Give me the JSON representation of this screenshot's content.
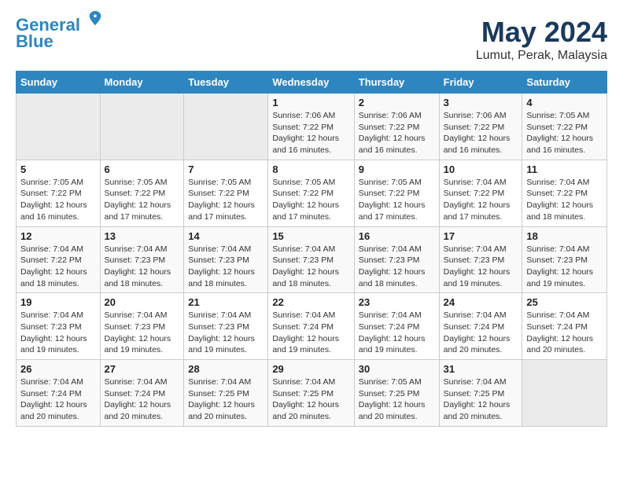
{
  "header": {
    "logo_line1": "General",
    "logo_line2": "Blue",
    "month": "May 2024",
    "location": "Lumut, Perak, Malaysia"
  },
  "weekdays": [
    "Sunday",
    "Monday",
    "Tuesday",
    "Wednesday",
    "Thursday",
    "Friday",
    "Saturday"
  ],
  "weeks": [
    [
      {
        "day": "",
        "sunrise": "",
        "sunset": "",
        "daylight": ""
      },
      {
        "day": "",
        "sunrise": "",
        "sunset": "",
        "daylight": ""
      },
      {
        "day": "",
        "sunrise": "",
        "sunset": "",
        "daylight": ""
      },
      {
        "day": "1",
        "sunrise": "Sunrise: 7:06 AM",
        "sunset": "Sunset: 7:22 PM",
        "daylight": "Daylight: 12 hours and 16 minutes."
      },
      {
        "day": "2",
        "sunrise": "Sunrise: 7:06 AM",
        "sunset": "Sunset: 7:22 PM",
        "daylight": "Daylight: 12 hours and 16 minutes."
      },
      {
        "day": "3",
        "sunrise": "Sunrise: 7:06 AM",
        "sunset": "Sunset: 7:22 PM",
        "daylight": "Daylight: 12 hours and 16 minutes."
      },
      {
        "day": "4",
        "sunrise": "Sunrise: 7:05 AM",
        "sunset": "Sunset: 7:22 PM",
        "daylight": "Daylight: 12 hours and 16 minutes."
      }
    ],
    [
      {
        "day": "5",
        "sunrise": "Sunrise: 7:05 AM",
        "sunset": "Sunset: 7:22 PM",
        "daylight": "Daylight: 12 hours and 16 minutes."
      },
      {
        "day": "6",
        "sunrise": "Sunrise: 7:05 AM",
        "sunset": "Sunset: 7:22 PM",
        "daylight": "Daylight: 12 hours and 17 minutes."
      },
      {
        "day": "7",
        "sunrise": "Sunrise: 7:05 AM",
        "sunset": "Sunset: 7:22 PM",
        "daylight": "Daylight: 12 hours and 17 minutes."
      },
      {
        "day": "8",
        "sunrise": "Sunrise: 7:05 AM",
        "sunset": "Sunset: 7:22 PM",
        "daylight": "Daylight: 12 hours and 17 minutes."
      },
      {
        "day": "9",
        "sunrise": "Sunrise: 7:05 AM",
        "sunset": "Sunset: 7:22 PM",
        "daylight": "Daylight: 12 hours and 17 minutes."
      },
      {
        "day": "10",
        "sunrise": "Sunrise: 7:04 AM",
        "sunset": "Sunset: 7:22 PM",
        "daylight": "Daylight: 12 hours and 17 minutes."
      },
      {
        "day": "11",
        "sunrise": "Sunrise: 7:04 AM",
        "sunset": "Sunset: 7:22 PM",
        "daylight": "Daylight: 12 hours and 18 minutes."
      }
    ],
    [
      {
        "day": "12",
        "sunrise": "Sunrise: 7:04 AM",
        "sunset": "Sunset: 7:22 PM",
        "daylight": "Daylight: 12 hours and 18 minutes."
      },
      {
        "day": "13",
        "sunrise": "Sunrise: 7:04 AM",
        "sunset": "Sunset: 7:23 PM",
        "daylight": "Daylight: 12 hours and 18 minutes."
      },
      {
        "day": "14",
        "sunrise": "Sunrise: 7:04 AM",
        "sunset": "Sunset: 7:23 PM",
        "daylight": "Daylight: 12 hours and 18 minutes."
      },
      {
        "day": "15",
        "sunrise": "Sunrise: 7:04 AM",
        "sunset": "Sunset: 7:23 PM",
        "daylight": "Daylight: 12 hours and 18 minutes."
      },
      {
        "day": "16",
        "sunrise": "Sunrise: 7:04 AM",
        "sunset": "Sunset: 7:23 PM",
        "daylight": "Daylight: 12 hours and 18 minutes."
      },
      {
        "day": "17",
        "sunrise": "Sunrise: 7:04 AM",
        "sunset": "Sunset: 7:23 PM",
        "daylight": "Daylight: 12 hours and 19 minutes."
      },
      {
        "day": "18",
        "sunrise": "Sunrise: 7:04 AM",
        "sunset": "Sunset: 7:23 PM",
        "daylight": "Daylight: 12 hours and 19 minutes."
      }
    ],
    [
      {
        "day": "19",
        "sunrise": "Sunrise: 7:04 AM",
        "sunset": "Sunset: 7:23 PM",
        "daylight": "Daylight: 12 hours and 19 minutes."
      },
      {
        "day": "20",
        "sunrise": "Sunrise: 7:04 AM",
        "sunset": "Sunset: 7:23 PM",
        "daylight": "Daylight: 12 hours and 19 minutes."
      },
      {
        "day": "21",
        "sunrise": "Sunrise: 7:04 AM",
        "sunset": "Sunset: 7:23 PM",
        "daylight": "Daylight: 12 hours and 19 minutes."
      },
      {
        "day": "22",
        "sunrise": "Sunrise: 7:04 AM",
        "sunset": "Sunset: 7:24 PM",
        "daylight": "Daylight: 12 hours and 19 minutes."
      },
      {
        "day": "23",
        "sunrise": "Sunrise: 7:04 AM",
        "sunset": "Sunset: 7:24 PM",
        "daylight": "Daylight: 12 hours and 19 minutes."
      },
      {
        "day": "24",
        "sunrise": "Sunrise: 7:04 AM",
        "sunset": "Sunset: 7:24 PM",
        "daylight": "Daylight: 12 hours and 20 minutes."
      },
      {
        "day": "25",
        "sunrise": "Sunrise: 7:04 AM",
        "sunset": "Sunset: 7:24 PM",
        "daylight": "Daylight: 12 hours and 20 minutes."
      }
    ],
    [
      {
        "day": "26",
        "sunrise": "Sunrise: 7:04 AM",
        "sunset": "Sunset: 7:24 PM",
        "daylight": "Daylight: 12 hours and 20 minutes."
      },
      {
        "day": "27",
        "sunrise": "Sunrise: 7:04 AM",
        "sunset": "Sunset: 7:24 PM",
        "daylight": "Daylight: 12 hours and 20 minutes."
      },
      {
        "day": "28",
        "sunrise": "Sunrise: 7:04 AM",
        "sunset": "Sunset: 7:25 PM",
        "daylight": "Daylight: 12 hours and 20 minutes."
      },
      {
        "day": "29",
        "sunrise": "Sunrise: 7:04 AM",
        "sunset": "Sunset: 7:25 PM",
        "daylight": "Daylight: 12 hours and 20 minutes."
      },
      {
        "day": "30",
        "sunrise": "Sunrise: 7:05 AM",
        "sunset": "Sunset: 7:25 PM",
        "daylight": "Daylight: 12 hours and 20 minutes."
      },
      {
        "day": "31",
        "sunrise": "Sunrise: 7:04 AM",
        "sunset": "Sunset: 7:25 PM",
        "daylight": "Daylight: 12 hours and 20 minutes."
      },
      {
        "day": "",
        "sunrise": "",
        "sunset": "",
        "daylight": ""
      }
    ]
  ]
}
